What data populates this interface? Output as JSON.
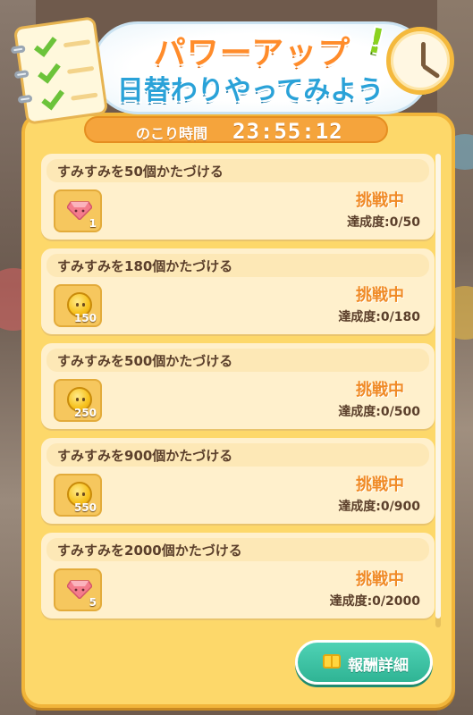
{
  "banner": {
    "title_line1": "パワーアップ",
    "title_line2": "日替わりやってみよう",
    "exclaim1": "!",
    "exclaim2": "!"
  },
  "timer": {
    "label": "のこり時間",
    "value": "23:55:12"
  },
  "missions": [
    {
      "title": "すみすみを50個かたづける",
      "reward_icon": "gem-icon",
      "reward_qty": "1",
      "status": "挑戦中",
      "progress": "達成度:0/50"
    },
    {
      "title": "すみすみを180個かたづける",
      "reward_icon": "coin-icon",
      "reward_qty": "150",
      "status": "挑戦中",
      "progress": "達成度:0/180"
    },
    {
      "title": "すみすみを500個かたづける",
      "reward_icon": "coin-icon",
      "reward_qty": "250",
      "status": "挑戦中",
      "progress": "達成度:0/500"
    },
    {
      "title": "すみすみを900個かたづける",
      "reward_icon": "coin-icon",
      "reward_qty": "550",
      "status": "挑戦中",
      "progress": "達成度:0/900"
    },
    {
      "title": "すみすみを2000個かたづける",
      "reward_icon": "gem-icon",
      "reward_qty": "5",
      "status": "挑戦中",
      "progress": "達成度:0/2000"
    }
  ],
  "detail_button": {
    "label": "報酬詳細",
    "icon": "book-icon"
  },
  "colors": {
    "panel": "#fdd86a",
    "timer_bar": "#f5a43c",
    "status_text": "#f08a25",
    "button": "#2fb494"
  }
}
